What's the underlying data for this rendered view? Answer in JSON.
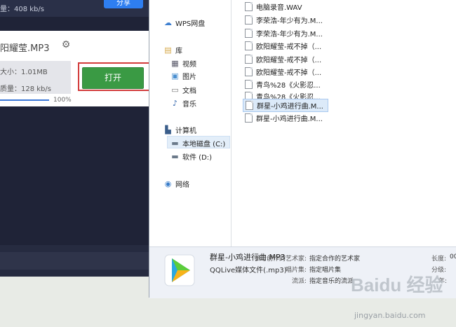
{
  "app": {
    "top_text": "量：408 kb/s",
    "top_button": "分享",
    "song_title": "阳耀莹.MP3",
    "size_label": "大小：1.01MB",
    "quality_label": "质量：128 kb/s",
    "open_button": "打开",
    "progress_percent": "100%",
    "progress_value": 1.0,
    "accent": "#3a9a44"
  },
  "dialog": {
    "nav": {
      "wps": "WPS网盘",
      "library": "库",
      "video": "视频",
      "pictures": "图片",
      "documents": "文档",
      "music": "音乐",
      "computer": "计算机",
      "local_disk": "本地磁盘 (C:)",
      "software": "软件 (D:)",
      "network": "网络"
    },
    "files": [
      "电脑录音.WAV",
      "李荣浩-年少有为.M...",
      "李荣浩-年少有为.M...",
      "欧阳耀莹-戒不掉（...",
      "欧阳耀莹-戒不掉（...",
      "欧阳耀莹-戒不掉（...",
      "青鸟%28《火影忍...",
      "青鸟%28《火影忍...",
      "群星-小鸡进行曲.M...",
      "群星-小鸡进行曲.M..."
    ],
    "selected_index": 8,
    "details": {
      "filename": "群星-小鸡进行曲.MP3",
      "filetype": "QQLive媒体文件(.mp3)",
      "artist_label": "参与创作的艺术家:",
      "artist_value": "指定合作的艺术家",
      "album_label": "唱片集:",
      "album_value": "指定唱片集",
      "genre_label": "流派:",
      "genre_value": "指定音乐的流派",
      "length_label": "长度:",
      "length_value": "00",
      "rating_label": "分级:",
      "year_label": "年:"
    }
  },
  "watermark": {
    "text": "jingyan.baidu.com",
    "brand": "Baidu 经验"
  }
}
